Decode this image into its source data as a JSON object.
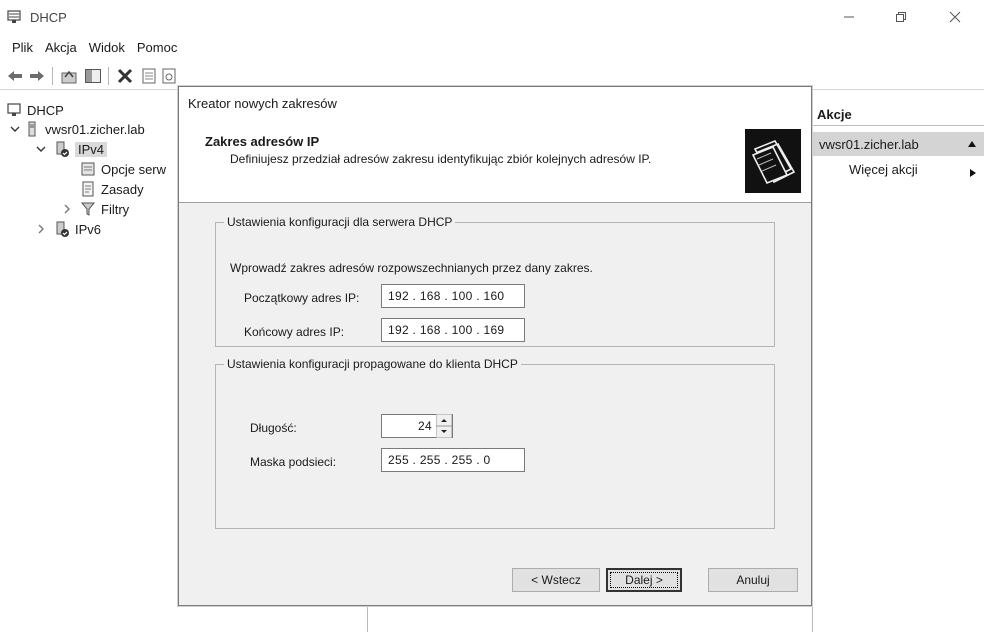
{
  "window": {
    "title": "DHCP"
  },
  "menu": [
    "Plik",
    "Akcja",
    "Widok",
    "Pomoc"
  ],
  "toolbar": [
    "back-icon",
    "forward-icon",
    "up-icon",
    "show-hide-tree-icon",
    "delete-icon",
    "properties-icon",
    "refresh-icon",
    "export-icon",
    "help-icon",
    "mmc-icon",
    "new-window-icon",
    "chat-icon"
  ],
  "tree": {
    "root": "DHCP",
    "server": "vwsr01.zicher.lab",
    "ipv4": "IPv4",
    "options": "Opcje serw",
    "policies": "Zasady",
    "filters": "Filtry",
    "ipv6": "IPv6"
  },
  "actions": {
    "header": "Akcje",
    "section": "vwsr01.zicher.lab",
    "more": "Więcej akcji"
  },
  "wizard": {
    "title": "Kreator nowych zakresów",
    "heading": "Zakres adresów IP",
    "subheading": "Definiujesz przedział adresów zakresu identyfikując zbiór kolejnych adresów IP.",
    "server_group": {
      "legend": "Ustawienia konfiguracji dla serwera DHCP",
      "hint": "Wprowadź zakres adresów rozpowszechnianych przez dany zakres.",
      "start_label": "Początkowy adres IP:",
      "start_value": "192 . 168 . 100 . 160",
      "end_label": "Końcowy adres IP:",
      "end_value": "192 . 168 . 100 . 169"
    },
    "client_group": {
      "legend": "Ustawienia konfiguracji propagowane do klienta DHCP",
      "length_label": "Długość:",
      "length_value": "24",
      "mask_label": "Maska podsieci:",
      "mask_value": "255 . 255 . 255 .  0"
    },
    "buttons": {
      "back": "< Wstecz",
      "next": "Dalej >",
      "cancel": "Anuluj"
    }
  }
}
